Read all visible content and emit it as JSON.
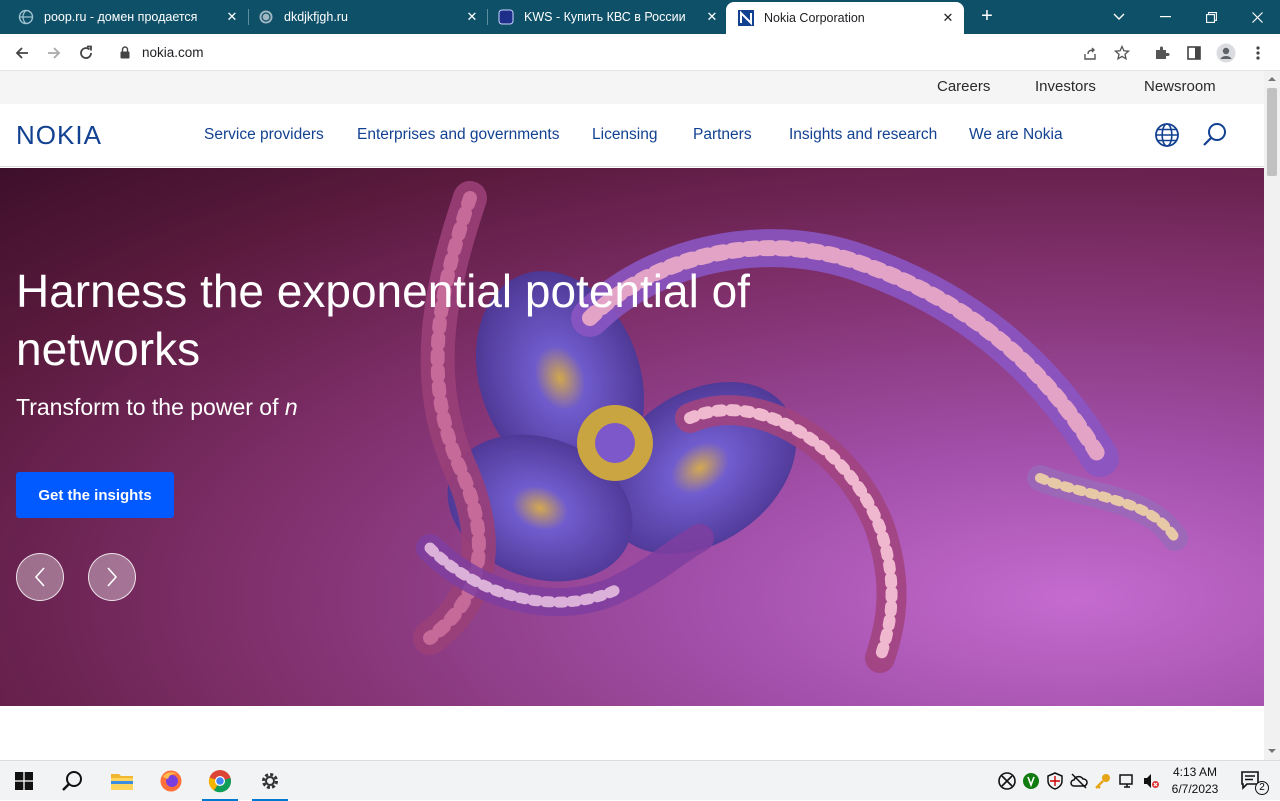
{
  "browser": {
    "tabs": [
      {
        "title": "poop.ru - домен продается",
        "favicon": "globe-icon"
      },
      {
        "title": "dkdjkfjgh.ru",
        "favicon": "globe-icon"
      },
      {
        "title": "KWS - Купить КВС в России",
        "favicon": "kws-icon"
      },
      {
        "title": "Nokia Corporation",
        "favicon": "nokia-icon",
        "active": true
      }
    ],
    "url": "nokia.com"
  },
  "site": {
    "utility_links": [
      "Careers",
      "Investors",
      "Newsroom"
    ],
    "logo_text": "NOKIA",
    "nav_links": [
      "Service providers",
      "Enterprises and governments",
      "Licensing",
      "Partners",
      "Insights and research",
      "We are Nokia"
    ],
    "hero": {
      "title": "Harness the exponential potential of networks",
      "subtitle_prefix": "Transform to the power of ",
      "subtitle_italic": "n",
      "cta_label": "Get the insights"
    },
    "colors": {
      "brand_blue": "#124191",
      "cta_blue": "#005aff",
      "tab_strip": "#0f5069"
    }
  },
  "taskbar": {
    "apps": [
      "windows-start-icon",
      "search-icon",
      "file-explorer-icon",
      "firefox-icon",
      "chrome-icon",
      "settings-icon"
    ],
    "time": "4:13 AM",
    "date": "6/7/2023",
    "notification_count": "2"
  }
}
